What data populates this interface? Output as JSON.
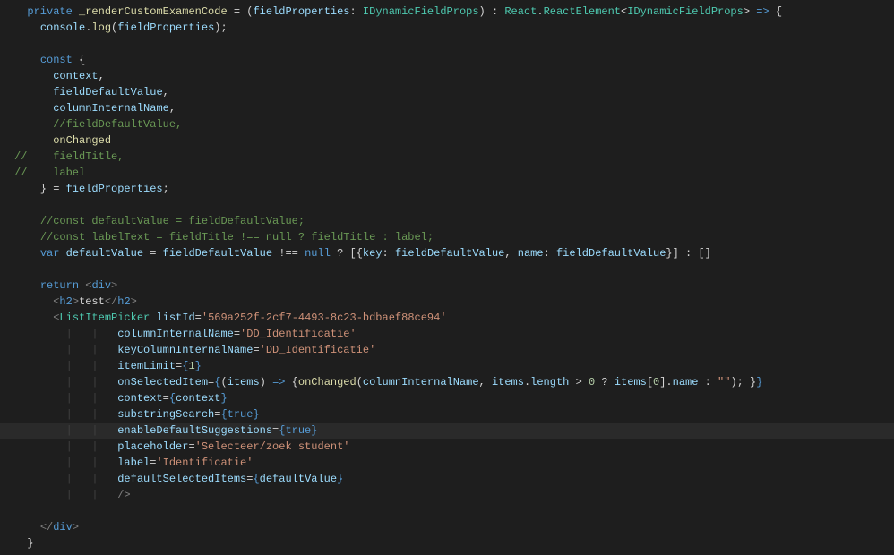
{
  "lines": [
    {
      "segments": [
        {
          "t": "  ",
          "c": ""
        },
        {
          "t": "private",
          "c": "kw-blue"
        },
        {
          "t": " ",
          "c": ""
        },
        {
          "t": "_renderCustomExamenCode",
          "c": "fn-yellow"
        },
        {
          "t": " = (",
          "c": "punc"
        },
        {
          "t": "fieldProperties",
          "c": "var-light"
        },
        {
          "t": ": ",
          "c": "punc"
        },
        {
          "t": "IDynamicFieldProps",
          "c": "type-teal"
        },
        {
          "t": ") : ",
          "c": "punc"
        },
        {
          "t": "React",
          "c": "type-teal"
        },
        {
          "t": ".",
          "c": "punc"
        },
        {
          "t": "ReactElement",
          "c": "type-teal"
        },
        {
          "t": "<",
          "c": "punc"
        },
        {
          "t": "IDynamicFieldProps",
          "c": "type-teal"
        },
        {
          "t": "> ",
          "c": "punc"
        },
        {
          "t": "=>",
          "c": "kw-blue"
        },
        {
          "t": " {",
          "c": "punc"
        }
      ]
    },
    {
      "segments": [
        {
          "t": "    ",
          "c": ""
        },
        {
          "t": "console",
          "c": "var-light"
        },
        {
          "t": ".",
          "c": "punc"
        },
        {
          "t": "log",
          "c": "fn-yellow"
        },
        {
          "t": "(",
          "c": "punc"
        },
        {
          "t": "fieldProperties",
          "c": "var-light"
        },
        {
          "t": ");",
          "c": "punc"
        }
      ]
    },
    {
      "segments": [
        {
          "t": "",
          "c": ""
        }
      ]
    },
    {
      "segments": [
        {
          "t": "    ",
          "c": ""
        },
        {
          "t": "const",
          "c": "kw-blue"
        },
        {
          "t": " {",
          "c": "punc"
        }
      ]
    },
    {
      "segments": [
        {
          "t": "      ",
          "c": ""
        },
        {
          "t": "context",
          "c": "var-light"
        },
        {
          "t": ",",
          "c": "punc"
        }
      ]
    },
    {
      "segments": [
        {
          "t": "      ",
          "c": ""
        },
        {
          "t": "fieldDefaultValue",
          "c": "var-light"
        },
        {
          "t": ",",
          "c": "punc"
        }
      ]
    },
    {
      "segments": [
        {
          "t": "      ",
          "c": ""
        },
        {
          "t": "columnInternalName",
          "c": "var-light"
        },
        {
          "t": ",",
          "c": "punc"
        }
      ]
    },
    {
      "segments": [
        {
          "t": "      ",
          "c": ""
        },
        {
          "t": "//fieldDefaultValue,",
          "c": "comment"
        }
      ]
    },
    {
      "segments": [
        {
          "t": "      ",
          "c": ""
        },
        {
          "t": "onChanged",
          "c": "fn-yellow"
        }
      ]
    },
    {
      "segments": [
        {
          "t": "//    fieldTitle,",
          "c": "comment"
        }
      ]
    },
    {
      "segments": [
        {
          "t": "//    label",
          "c": "comment"
        }
      ]
    },
    {
      "segments": [
        {
          "t": "    } = ",
          "c": "punc"
        },
        {
          "t": "fieldProperties",
          "c": "var-light"
        },
        {
          "t": ";",
          "c": "punc"
        }
      ]
    },
    {
      "segments": [
        {
          "t": "",
          "c": ""
        }
      ]
    },
    {
      "segments": [
        {
          "t": "    ",
          "c": ""
        },
        {
          "t": "//const defaultValue = fieldDefaultValue;",
          "c": "comment"
        }
      ]
    },
    {
      "segments": [
        {
          "t": "    ",
          "c": ""
        },
        {
          "t": "//const labelText = fieldTitle !== null ? fieldTitle : label;",
          "c": "comment"
        }
      ]
    },
    {
      "segments": [
        {
          "t": "    ",
          "c": ""
        },
        {
          "t": "var",
          "c": "kw-blue"
        },
        {
          "t": " ",
          "c": ""
        },
        {
          "t": "defaultValue",
          "c": "var-light"
        },
        {
          "t": " = ",
          "c": "punc"
        },
        {
          "t": "fieldDefaultValue",
          "c": "var-light"
        },
        {
          "t": " !== ",
          "c": "punc"
        },
        {
          "t": "null",
          "c": "kw-blue"
        },
        {
          "t": " ? [{",
          "c": "punc"
        },
        {
          "t": "key",
          "c": "var-light"
        },
        {
          "t": ": ",
          "c": "punc"
        },
        {
          "t": "fieldDefaultValue",
          "c": "var-light"
        },
        {
          "t": ", ",
          "c": "punc"
        },
        {
          "t": "name",
          "c": "var-light"
        },
        {
          "t": ": ",
          "c": "punc"
        },
        {
          "t": "fieldDefaultValue",
          "c": "var-light"
        },
        {
          "t": "}] : []",
          "c": "punc"
        }
      ]
    },
    {
      "segments": [
        {
          "t": "",
          "c": ""
        }
      ]
    },
    {
      "segments": [
        {
          "t": "    ",
          "c": ""
        },
        {
          "t": "return",
          "c": "kw-blue"
        },
        {
          "t": " ",
          "c": ""
        },
        {
          "t": "<",
          "c": "tag-gray"
        },
        {
          "t": "div",
          "c": "kw-blue"
        },
        {
          "t": ">",
          "c": "tag-gray"
        }
      ]
    },
    {
      "segments": [
        {
          "t": "      ",
          "c": ""
        },
        {
          "t": "<",
          "c": "tag-gray"
        },
        {
          "t": "h2",
          "c": "kw-blue"
        },
        {
          "t": ">",
          "c": "tag-gray"
        },
        {
          "t": "test",
          "c": "punc"
        },
        {
          "t": "</",
          "c": "tag-gray"
        },
        {
          "t": "h2",
          "c": "kw-blue"
        },
        {
          "t": ">",
          "c": "tag-gray"
        }
      ]
    },
    {
      "segments": [
        {
          "t": "      ",
          "c": ""
        },
        {
          "t": "<",
          "c": "tag-gray"
        },
        {
          "t": "ListItemPicker",
          "c": "type-teal"
        },
        {
          "t": " ",
          "c": ""
        },
        {
          "t": "listId",
          "c": "var-light"
        },
        {
          "t": "=",
          "c": "punc"
        },
        {
          "t": "'569a252f-2cf7-4493-8c23-bdbaef88ce94'",
          "c": "str"
        }
      ]
    },
    {
      "segments": [
        {
          "t": "        ",
          "c": ""
        },
        {
          "t": "|   |   ",
          "c": "guide"
        },
        {
          "t": "columnInternalName",
          "c": "var-light"
        },
        {
          "t": "=",
          "c": "punc"
        },
        {
          "t": "'DD_Identificatie'",
          "c": "str"
        }
      ]
    },
    {
      "segments": [
        {
          "t": "        ",
          "c": ""
        },
        {
          "t": "|   |   ",
          "c": "guide"
        },
        {
          "t": "keyColumnInternalName",
          "c": "var-light"
        },
        {
          "t": "=",
          "c": "punc"
        },
        {
          "t": "'DD_Identificatie'",
          "c": "str"
        }
      ]
    },
    {
      "segments": [
        {
          "t": "        ",
          "c": ""
        },
        {
          "t": "|   |   ",
          "c": "guide"
        },
        {
          "t": "itemLimit",
          "c": "var-light"
        },
        {
          "t": "=",
          "c": "punc"
        },
        {
          "t": "{",
          "c": "kw-blue"
        },
        {
          "t": "1",
          "c": "num"
        },
        {
          "t": "}",
          "c": "kw-blue"
        }
      ]
    },
    {
      "segments": [
        {
          "t": "        ",
          "c": ""
        },
        {
          "t": "|   |   ",
          "c": "guide"
        },
        {
          "t": "onSelectedItem",
          "c": "var-light"
        },
        {
          "t": "=",
          "c": "punc"
        },
        {
          "t": "{",
          "c": "kw-blue"
        },
        {
          "t": "(",
          "c": "punc"
        },
        {
          "t": "items",
          "c": "var-light"
        },
        {
          "t": ") ",
          "c": "punc"
        },
        {
          "t": "=>",
          "c": "kw-blue"
        },
        {
          "t": " {",
          "c": "punc"
        },
        {
          "t": "onChanged",
          "c": "fn-yellow"
        },
        {
          "t": "(",
          "c": "punc"
        },
        {
          "t": "columnInternalName",
          "c": "var-light"
        },
        {
          "t": ", ",
          "c": "punc"
        },
        {
          "t": "items",
          "c": "var-light"
        },
        {
          "t": ".",
          "c": "punc"
        },
        {
          "t": "length",
          "c": "var-light"
        },
        {
          "t": " > ",
          "c": "punc"
        },
        {
          "t": "0",
          "c": "num"
        },
        {
          "t": " ? ",
          "c": "punc"
        },
        {
          "t": "items",
          "c": "var-light"
        },
        {
          "t": "[",
          "c": "punc"
        },
        {
          "t": "0",
          "c": "num"
        },
        {
          "t": "].",
          "c": "punc"
        },
        {
          "t": "name",
          "c": "var-light"
        },
        {
          "t": " : ",
          "c": "punc"
        },
        {
          "t": "\"\"",
          "c": "str"
        },
        {
          "t": "); }",
          "c": "punc"
        },
        {
          "t": "}",
          "c": "kw-blue"
        }
      ]
    },
    {
      "segments": [
        {
          "t": "        ",
          "c": ""
        },
        {
          "t": "|   |   ",
          "c": "guide"
        },
        {
          "t": "context",
          "c": "var-light"
        },
        {
          "t": "=",
          "c": "punc"
        },
        {
          "t": "{",
          "c": "kw-blue"
        },
        {
          "t": "context",
          "c": "var-light"
        },
        {
          "t": "}",
          "c": "kw-blue"
        }
      ]
    },
    {
      "segments": [
        {
          "t": "        ",
          "c": ""
        },
        {
          "t": "|   |   ",
          "c": "guide"
        },
        {
          "t": "substringSearch",
          "c": "var-light"
        },
        {
          "t": "=",
          "c": "punc"
        },
        {
          "t": "{",
          "c": "kw-blue"
        },
        {
          "t": "true",
          "c": "kw-blue"
        },
        {
          "t": "}",
          "c": "kw-blue"
        }
      ]
    },
    {
      "hl": true,
      "segments": [
        {
          "t": "        ",
          "c": ""
        },
        {
          "t": "|   |   ",
          "c": "guide"
        },
        {
          "t": "enableDefaultSuggestions",
          "c": "var-light"
        },
        {
          "t": "=",
          "c": "punc"
        },
        {
          "t": "{",
          "c": "kw-blue"
        },
        {
          "t": "true",
          "c": "kw-blue"
        },
        {
          "t": "}",
          "c": "kw-blue"
        }
      ]
    },
    {
      "segments": [
        {
          "t": "        ",
          "c": ""
        },
        {
          "t": "|   |   ",
          "c": "guide"
        },
        {
          "t": "placeholder",
          "c": "var-light"
        },
        {
          "t": "=",
          "c": "punc"
        },
        {
          "t": "'Selecteer/zoek student'",
          "c": "str"
        }
      ]
    },
    {
      "segments": [
        {
          "t": "        ",
          "c": ""
        },
        {
          "t": "|   |   ",
          "c": "guide"
        },
        {
          "t": "label",
          "c": "var-light"
        },
        {
          "t": "=",
          "c": "punc"
        },
        {
          "t": "'Identificatie'",
          "c": "str"
        }
      ]
    },
    {
      "segments": [
        {
          "t": "        ",
          "c": ""
        },
        {
          "t": "|   |   ",
          "c": "guide"
        },
        {
          "t": "defaultSelectedItems",
          "c": "var-light"
        },
        {
          "t": "=",
          "c": "punc"
        },
        {
          "t": "{",
          "c": "kw-blue"
        },
        {
          "t": "defaultValue",
          "c": "var-light"
        },
        {
          "t": "}",
          "c": "kw-blue"
        }
      ]
    },
    {
      "segments": [
        {
          "t": "        ",
          "c": ""
        },
        {
          "t": "|   |   ",
          "c": "guide"
        },
        {
          "t": "/>",
          "c": "tag-gray"
        }
      ]
    },
    {
      "segments": [
        {
          "t": "",
          "c": ""
        }
      ]
    },
    {
      "segments": [
        {
          "t": "    ",
          "c": ""
        },
        {
          "t": "</",
          "c": "tag-gray"
        },
        {
          "t": "div",
          "c": "kw-blue"
        },
        {
          "t": ">",
          "c": "tag-gray"
        }
      ]
    },
    {
      "segments": [
        {
          "t": "  }",
          "c": "punc"
        }
      ]
    }
  ]
}
